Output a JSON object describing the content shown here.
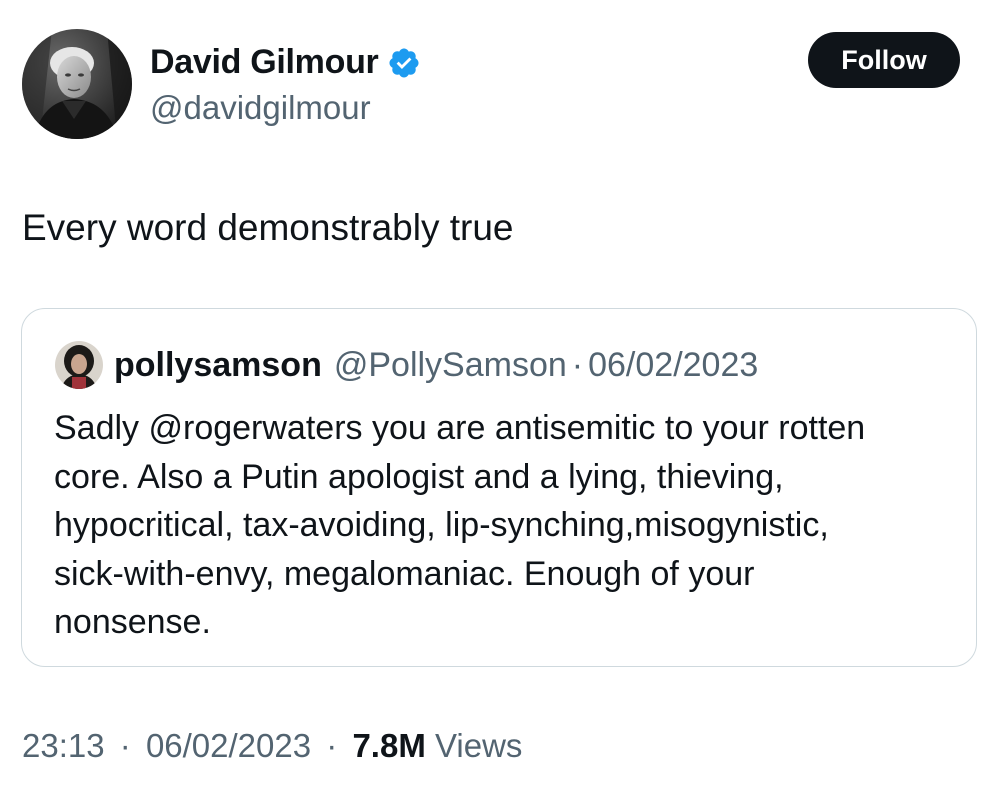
{
  "author": {
    "name": "David Gilmour",
    "handle": "@davidgilmour",
    "verified": true,
    "verified_color": "#1d9bf0"
  },
  "follow_button": {
    "label": "Follow"
  },
  "tweet": {
    "text": "Every word demonstrably true",
    "time": "23:13",
    "separator": "·",
    "date": "06/02/2023",
    "views_count": "7.8M",
    "views_label": "Views"
  },
  "quoted_tweet": {
    "name": "pollysamson",
    "handle": "@PollySamson",
    "separator": "·",
    "date": "06/02/2023",
    "text_lines": [
      "Sadly @rogerwaters you are antisemitic to your rotten",
      "core. Also a Putin apologist and a lying, thieving,",
      "hypocritical, tax-avoiding, lip-synching,misogynistic,",
      "sick-with-envy, megalomaniac. Enough of your",
      "nonsense."
    ]
  },
  "colors": {
    "text_primary": "#0f1419",
    "text_secondary": "#536471",
    "border": "#cfd9de",
    "button_bg": "#0f1419",
    "button_text": "#ffffff"
  }
}
